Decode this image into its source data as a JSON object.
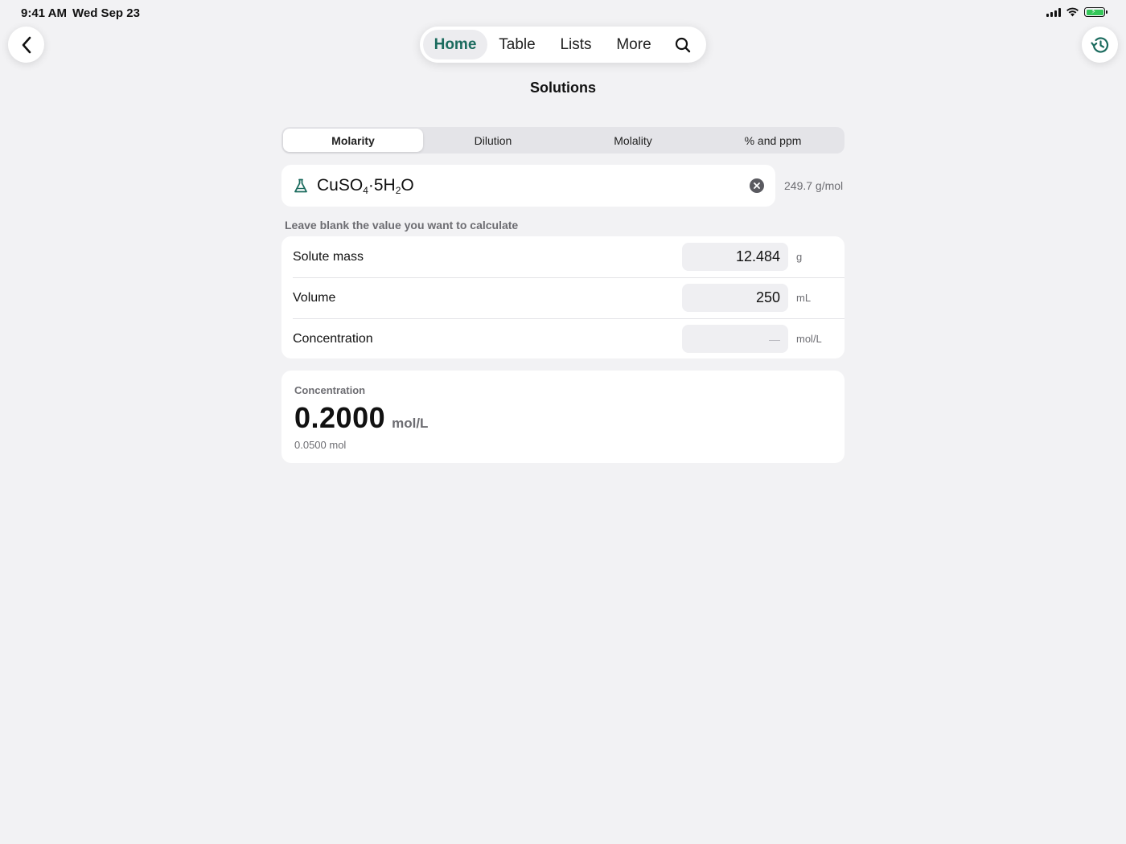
{
  "status_bar": {
    "time": "9:41 AM",
    "date": "Wed Sep 23"
  },
  "nav": {
    "items": [
      {
        "label": "Home",
        "active": true
      },
      {
        "label": "Table",
        "active": false
      },
      {
        "label": "Lists",
        "active": false
      },
      {
        "label": "More",
        "active": false
      }
    ],
    "search_icon": "search-icon"
  },
  "page": {
    "title": "Solutions"
  },
  "tabs": [
    {
      "label": "Molarity",
      "active": true
    },
    {
      "label": "Dilution",
      "active": false
    },
    {
      "label": "Molality",
      "active": false
    },
    {
      "label": "% and ppm",
      "active": false
    }
  ],
  "compound": {
    "formula_parts": [
      "CuSO",
      "4",
      "·5H",
      "2",
      "O"
    ],
    "molar_mass": "249.7 g/mol",
    "icon": "flask-icon"
  },
  "hint": "Leave blank the value you want to calculate",
  "fields": [
    {
      "label": "Solute mass",
      "value": "12.484",
      "unit": "g"
    },
    {
      "label": "Volume",
      "value": "250",
      "unit": "mL"
    },
    {
      "label": "Concentration",
      "value": "—",
      "unit": "mol/L"
    }
  ],
  "result": {
    "label": "Concentration",
    "value": "0.2000",
    "unit": "mol/L",
    "moles": "0.0500 mol"
  },
  "colors": {
    "accent": "#1b6b5e",
    "background": "#f2f2f4",
    "battery": "#34c759"
  }
}
